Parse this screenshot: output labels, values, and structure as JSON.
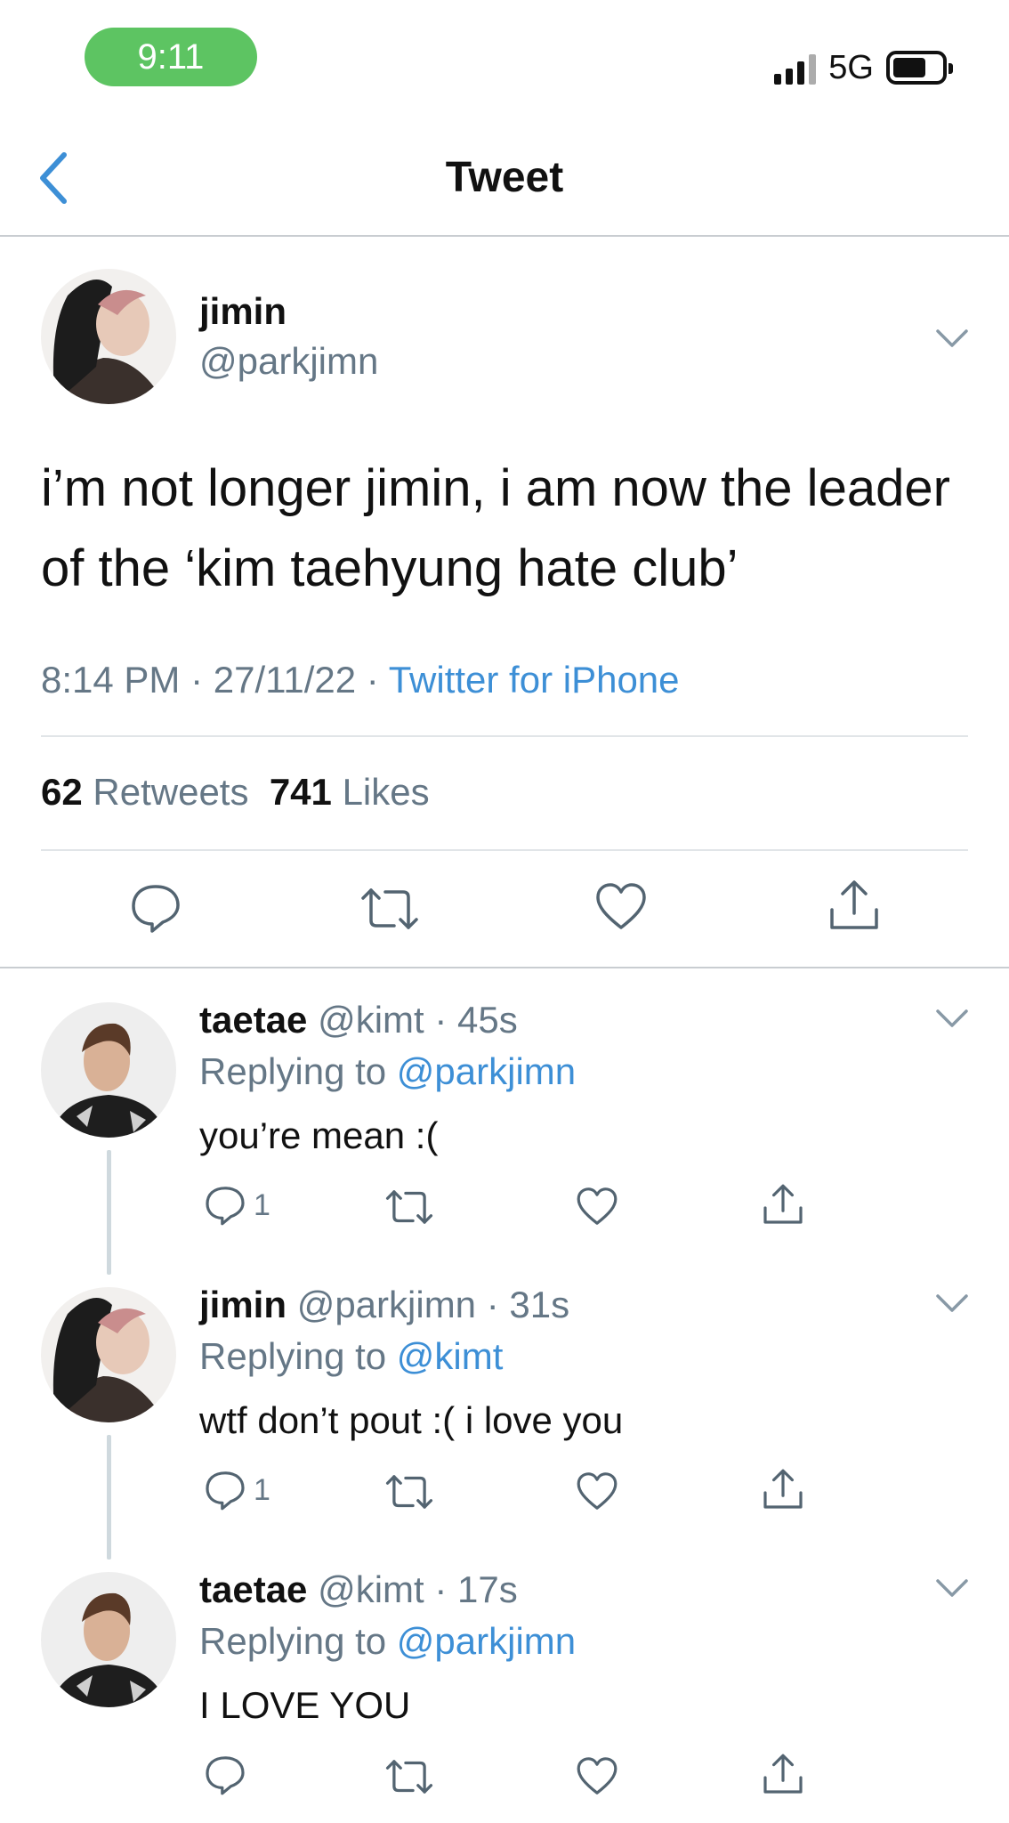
{
  "status_bar": {
    "time": "9:11",
    "network": "5G"
  },
  "nav": {
    "title": "Tweet"
  },
  "main_tweet": {
    "name": "jimin",
    "handle": "@parkjimn",
    "text": "i’m not longer jimin, i am now the leader of the ‘kim taehyung hate club’",
    "time": "8:14 PM",
    "date": "27/11/22",
    "source": "Twitter for iPhone",
    "retweets_count": "62",
    "retweets_label": "Retweets",
    "likes_count": "741",
    "likes_label": "Likes"
  },
  "replies": [
    {
      "name": "taetae",
      "handle": "@kimt",
      "time": "45s",
      "replying_label": "Replying to",
      "replying_to": "@parkjimn",
      "text": "you’re mean :(",
      "reply_count": "1",
      "avatar": "taehyung-avatar"
    },
    {
      "name": "jimin",
      "handle": "@parkjimn",
      "time": "31s",
      "replying_label": "Replying to",
      "replying_to": "@kimt",
      "text": "wtf don’t pout :( i love you",
      "reply_count": "1",
      "avatar": "jimin-avatar"
    },
    {
      "name": "taetae",
      "handle": "@kimt",
      "time": "17s",
      "replying_label": "Replying to",
      "replying_to": "@parkjimn",
      "text": "I LOVE YOU",
      "reply_count": "",
      "avatar": "taehyung-avatar"
    }
  ],
  "colors": {
    "accent": "#3d8fd6",
    "muted": "#657786",
    "status_pill": "#5dc462"
  }
}
